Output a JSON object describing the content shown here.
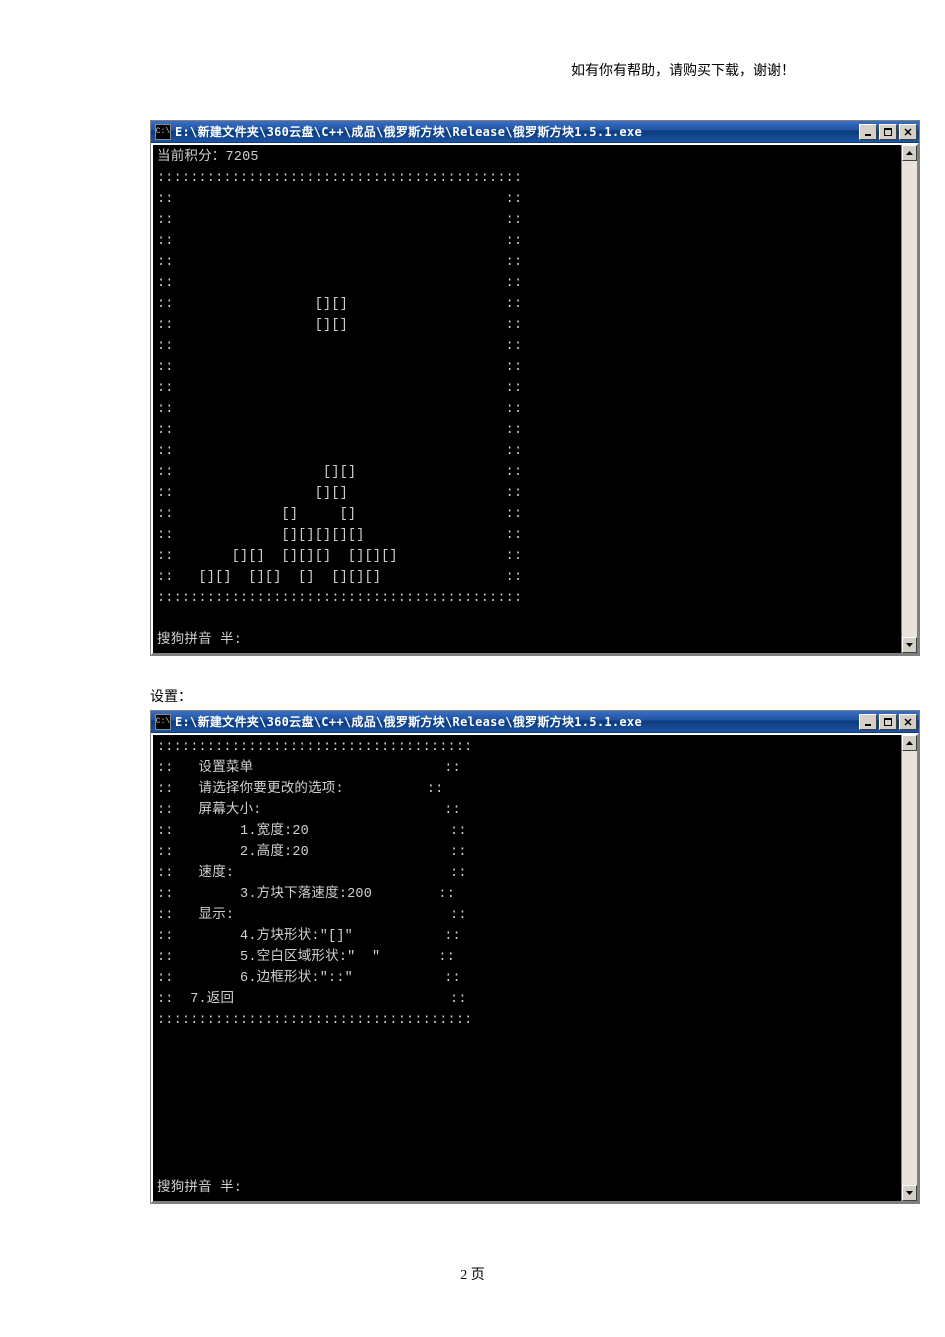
{
  "header_text": "如有你有帮助，请购买下载，谢谢！",
  "section_label_settings": "设置：",
  "page_footer": "2 页",
  "window1": {
    "icon_text": "C:\\",
    "title": "E:\\新建文件夹\\360云盘\\C++\\成品\\俄罗斯方块\\Release\\俄罗斯方块1.5.1.exe",
    "score_line": "当前积分：7205",
    "ime_line": "搜狗拼音 半:",
    "rows": [
      "::::::::::::::::::::::::::::::::::::::::::::",
      "::                                        ::",
      "::                                        ::",
      "::                                        ::",
      "::                                        ::",
      "::                                        ::",
      "::                 [][]                   ::",
      "::                 [][]                   ::",
      "::                                        ::",
      "::                                        ::",
      "::                                        ::",
      "::                                        ::",
      "::                                        ::",
      "::                                        ::",
      "::                  [][]                  ::",
      "::                 [][]                   ::",
      "::             []     []                  ::",
      "::             [][][][][]                 ::",
      "::       [][]  [][][]  [][][]             ::",
      "::   [][]  [][]  []  [][][]               ::",
      "::::::::::::::::::::::::::::::::::::::::::::"
    ]
  },
  "window2": {
    "icon_text": "C:\\",
    "title": "E:\\新建文件夹\\360云盘\\C++\\成品\\俄罗斯方块\\Release\\俄罗斯方块1.5.1.exe",
    "ime_line": "搜狗拼音 半:",
    "rows": [
      "::::::::::::::::::::::::::::::::::::::",
      "::   设置菜单                       ::",
      "::   请选择你要更改的选项:          ::",
      "::   屏幕大小:                      ::",
      "::        1.宽度:20                 ::",
      "::        2.高度:20                 ::",
      "::   速度:                          ::",
      "::        3.方块下落速度:200        ::",
      "::   显示:                          ::",
      "::        4.方块形状:\"[]\"           ::",
      "::        5.空白区域形状:\"  \"       ::",
      "::        6.边框形状:\"::\"           ::",
      "::  7.返回                          ::",
      "::::::::::::::::::::::::::::::::::::::"
    ],
    "blank_rows": 7
  }
}
